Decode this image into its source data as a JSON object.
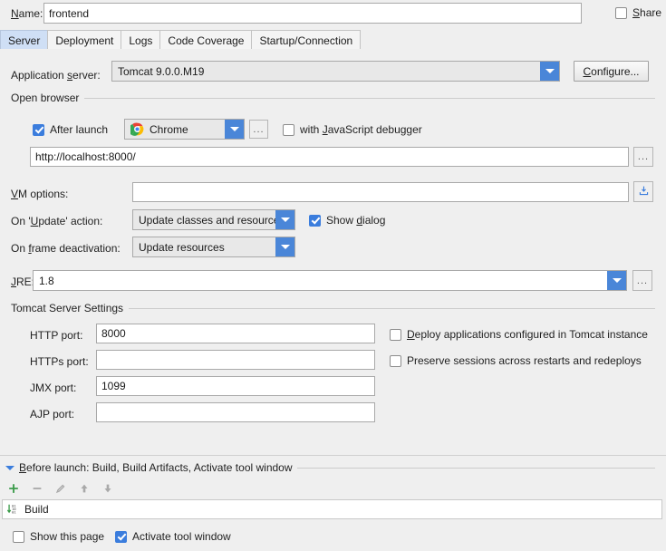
{
  "name_row": {
    "label": "Name:",
    "value": "frontend",
    "share_label": "Share",
    "share_checked": false
  },
  "tabs": [
    {
      "label": "Server",
      "active": true
    },
    {
      "label": "Deployment",
      "active": false
    },
    {
      "label": "Logs",
      "active": false
    },
    {
      "label": "Code Coverage",
      "active": false
    },
    {
      "label": "Startup/Connection",
      "active": false
    }
  ],
  "server": {
    "app_server_label": "Application server:",
    "app_server_value": "Tomcat 9.0.0.M19",
    "configure_button": "Configure...",
    "open_browser_section": "Open browser",
    "after_launch_label": "After launch",
    "after_launch_checked": true,
    "browser_value": "Chrome",
    "browser_icon": "chrome-icon",
    "browse_ellipsis": "...",
    "js_debugger_label": "with JavaScript debugger",
    "js_debugger_checked": false,
    "url_value": "http://localhost:8000/",
    "vm_options_label": "VM options:",
    "vm_options_value": "",
    "vm_options_icon": "expand-editor-icon",
    "update_action_label": "On 'Update' action:",
    "update_action_value": "Update classes and resources",
    "show_dialog_label": "Show dialog",
    "show_dialog_checked": true,
    "frame_deactivation_label": "On frame deactivation:",
    "frame_deactivation_value": "Update resources",
    "jre_label": "JRE:",
    "jre_value": "1.8"
  },
  "tomcat": {
    "section_label": "Tomcat Server Settings",
    "ports": [
      {
        "label": "HTTP port:",
        "value": "8000"
      },
      {
        "label": "HTTPs port:",
        "value": ""
      },
      {
        "label": "JMX port:",
        "value": "1099"
      },
      {
        "label": "AJP port:",
        "value": ""
      }
    ],
    "deploy_label": "Deploy applications configured in Tomcat instance",
    "deploy_checked": false,
    "preserve_label": "Preserve sessions across restarts and redeploys",
    "preserve_checked": false
  },
  "before_launch": {
    "header": "Before launch: Build, Build Artifacts, Activate tool window",
    "toolbar": {
      "add": "+",
      "remove": "−",
      "edit": "edit-pencil-icon",
      "up": "move-up-icon",
      "down": "move-down-icon"
    },
    "items": [
      {
        "icon": "compile-build-icon",
        "label": "Build"
      }
    ],
    "show_page_label": "Show this page",
    "show_page_checked": false,
    "activate_tool_window_label": "Activate tool window",
    "activate_tool_window_checked": true
  }
}
